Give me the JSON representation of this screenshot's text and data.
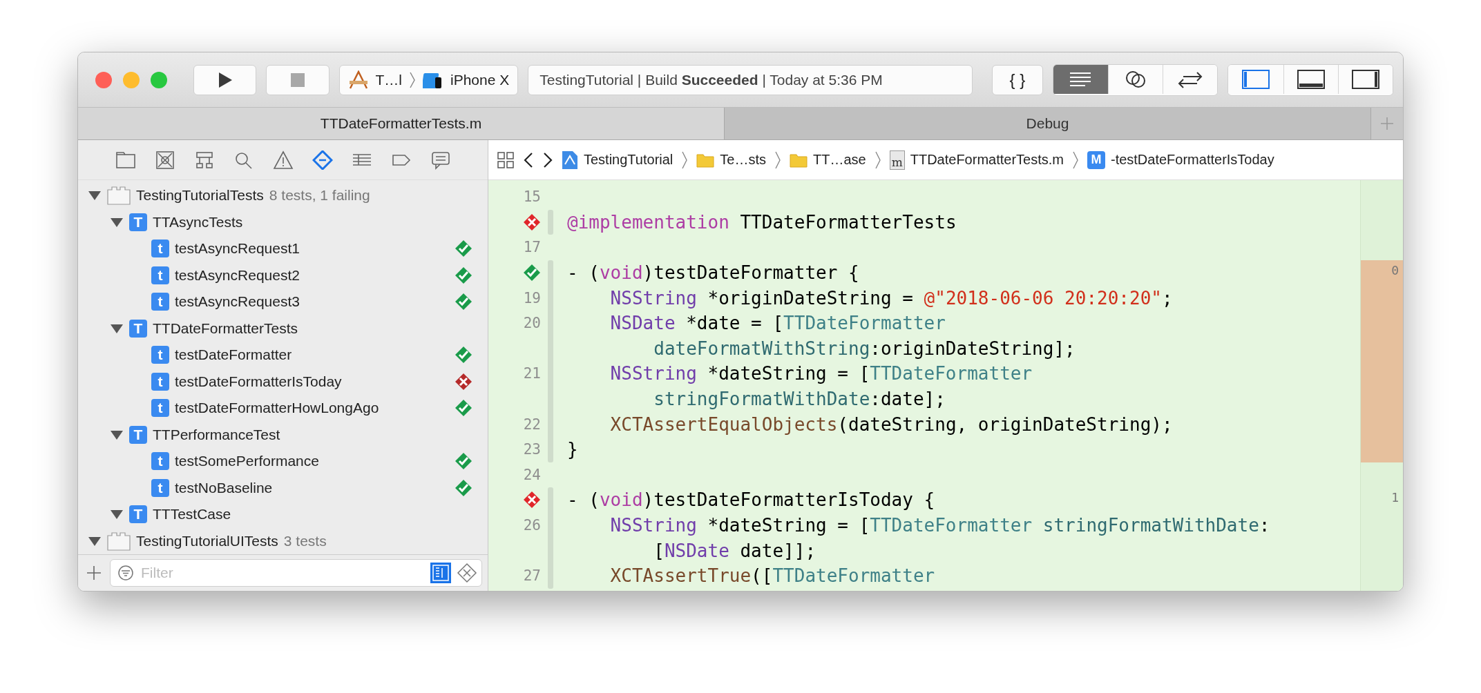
{
  "toolbar": {
    "scheme": {
      "target": "T…l",
      "device": "iPhone X"
    },
    "activity": "TestingTutorial | Build **Succeeded** | Today at 5:36 PM",
    "code_button": "{ }",
    "editor_modes": [
      {
        "selected": true
      },
      {
        "selected": false
      },
      {
        "selected": false
      }
    ],
    "panels": [
      {
        "selected": true
      },
      {
        "selected": false
      },
      {
        "selected": false
      }
    ]
  },
  "tabs": [
    {
      "label": "TTDateFormatterTests.m",
      "selected": true
    },
    {
      "label": "Debug",
      "selected": false
    }
  ],
  "navigator": {
    "icons": [
      {
        "selected": false
      },
      {
        "selected": false
      },
      {
        "selected": false
      },
      {
        "selected": false
      },
      {
        "selected": false
      },
      {
        "selected": true
      },
      {
        "selected": false
      },
      {
        "selected": false
      },
      {
        "selected": false
      }
    ],
    "tree": [
      {
        "name": "TestingTutorialTests",
        "detail": "8 tests, 1 failing",
        "kind": "bundle",
        "expanded": true,
        "children": [
          {
            "name": "TTAsyncTests",
            "kind": "class",
            "badge": "T",
            "expanded": true,
            "children": [
              {
                "name": "testAsyncRequest1",
                "kind": "test",
                "badge": "t",
                "passed": true
              },
              {
                "name": "testAsyncRequest2",
                "kind": "test",
                "badge": "t",
                "passed": true
              },
              {
                "name": "testAsyncRequest3",
                "kind": "test",
                "badge": "t",
                "passed": true
              }
            ]
          },
          {
            "name": "TTDateFormatterTests",
            "kind": "class",
            "badge": "T",
            "expanded": true,
            "children": [
              {
                "name": "testDateFormatter",
                "kind": "test",
                "badge": "t",
                "passed": true
              },
              {
                "name": "testDateFormatterIsToday",
                "kind": "test",
                "badge": "t",
                "passed": false
              },
              {
                "name": "testDateFormatterHowLongAgo",
                "kind": "test",
                "badge": "t",
                "passed": true
              }
            ]
          },
          {
            "name": "TTPerformanceTest",
            "kind": "class",
            "badge": "T",
            "expanded": true,
            "children": [
              {
                "name": "testSomePerformance",
                "kind": "test",
                "badge": "t",
                "passed": true
              },
              {
                "name": "testNoBaseline",
                "kind": "test",
                "badge": "t",
                "passed": true
              }
            ]
          },
          {
            "name": "TTTestCase",
            "kind": "class",
            "badge": "T",
            "expanded": true
          }
        ]
      },
      {
        "name": "TestingTutorialUITests",
        "detail": "3 tests",
        "kind": "bundle",
        "expanded": true
      }
    ],
    "filter": {
      "placeholder": "Filter"
    }
  },
  "jump_bar": {
    "crumbs": [
      {
        "label": "TestingTutorial",
        "kind": "project"
      },
      {
        "label": "Te…sts",
        "kind": "folder"
      },
      {
        "label": "TT…ase",
        "kind": "folder"
      },
      {
        "label": "TTDateFormatterTests.m",
        "kind": "file",
        "badge": "m"
      },
      {
        "label": "-testDateFormatterIsToday",
        "kind": "method",
        "badge": "M"
      }
    ]
  },
  "editor": {
    "lines": [
      {
        "number": "15"
      },
      {
        "passed": false,
        "tokens": [
          {
            "kind": "keyword",
            "text": "@implementation"
          },
          {
            "kind": "plain",
            "text": " TTDateFormatterTests"
          }
        ]
      },
      {
        "number": "17"
      },
      {
        "passed": true,
        "uncovered": true,
        "count": "0",
        "tokens": [
          {
            "kind": "plain",
            "text": "- ("
          },
          {
            "kind": "keyword",
            "text": "void"
          },
          {
            "kind": "plain",
            "text": ")testDateFormatter {"
          }
        ]
      },
      {
        "number": "19",
        "uncovered": true,
        "tokens": [
          {
            "kind": "type",
            "text": "    NSString"
          },
          {
            "kind": "plain",
            "text": " *originDateString = "
          },
          {
            "kind": "string",
            "text": "@\"2018-06-06 20:20:20\""
          },
          {
            "kind": "plain",
            "text": ";"
          }
        ]
      },
      {
        "number": "20",
        "uncovered": true,
        "tokens": [
          {
            "kind": "type",
            "text": "    NSDate"
          },
          {
            "kind": "plain",
            "text": " *date = ["
          },
          {
            "kind": "class",
            "text": "TTDateFormatter"
          }
        ]
      },
      {
        "uncovered": true,
        "tokens": [
          {
            "kind": "method",
            "text": "        dateFormatWithString"
          },
          {
            "kind": "plain",
            "text": ":originDateString];"
          }
        ]
      },
      {
        "number": "21",
        "uncovered": true,
        "tokens": [
          {
            "kind": "type",
            "text": "    NSString"
          },
          {
            "kind": "plain",
            "text": " *dateString = ["
          },
          {
            "kind": "class",
            "text": "TTDateFormatter"
          }
        ]
      },
      {
        "uncovered": true,
        "tokens": [
          {
            "kind": "method",
            "text": "        stringFormatWithDate"
          },
          {
            "kind": "plain",
            "text": ":date];"
          }
        ]
      },
      {
        "number": "22",
        "uncovered": true,
        "tokens": [
          {
            "kind": "macro",
            "text": "    XCTAssertEqualObjects"
          },
          {
            "kind": "plain",
            "text": "(dateString, originDateString);"
          }
        ]
      },
      {
        "number": "23",
        "uncovered": true,
        "tokens": [
          {
            "kind": "plain",
            "text": "}"
          }
        ]
      },
      {
        "number": "24"
      },
      {
        "passed": false,
        "count": "1",
        "tokens": [
          {
            "kind": "plain",
            "text": "- ("
          },
          {
            "kind": "keyword",
            "text": "void"
          },
          {
            "kind": "plain",
            "text": ")testDateFormatterIsToday {"
          }
        ]
      },
      {
        "number": "26",
        "tokens": [
          {
            "kind": "type",
            "text": "    NSString"
          },
          {
            "kind": "plain",
            "text": " *dateString = ["
          },
          {
            "kind": "class",
            "text": "TTDateFormatter"
          },
          {
            "kind": "method",
            "text": " stringFormatWithDate"
          },
          {
            "kind": "plain",
            "text": ":"
          }
        ]
      },
      {
        "tokens": [
          {
            "kind": "plain",
            "text": "        ["
          },
          {
            "kind": "type",
            "text": "NSDate"
          },
          {
            "kind": "plain",
            "text": " date]];"
          }
        ]
      },
      {
        "number": "27",
        "tokens": [
          {
            "kind": "macro",
            "text": "    XCTAssertTrue"
          },
          {
            "kind": "plain",
            "text": "(["
          },
          {
            "kind": "class",
            "text": "TTDateFormatter"
          }
        ]
      }
    ]
  }
}
